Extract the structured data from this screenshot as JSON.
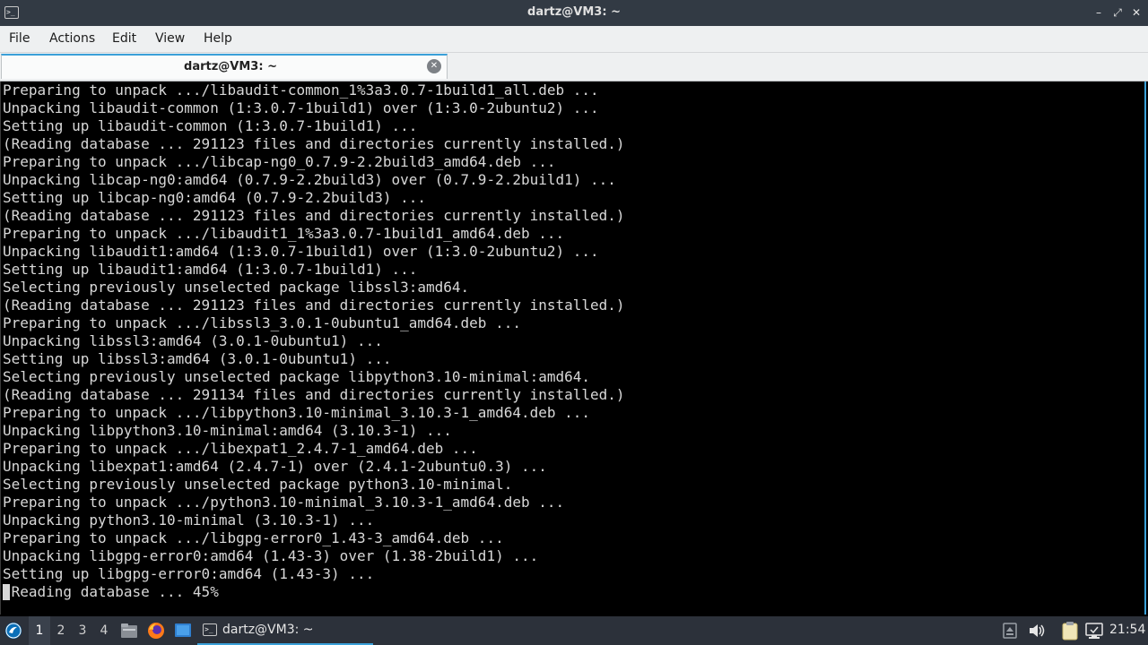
{
  "window": {
    "title": "dartz@VM3: ~",
    "icon": "terminal-icon",
    "controls": {
      "minimize": "–",
      "maximize": "⤢",
      "close": "✕"
    }
  },
  "menubar": {
    "file": "File",
    "actions": "Actions",
    "edit": "Edit",
    "view": "View",
    "help": "Help"
  },
  "tabs": [
    {
      "label": "dartz@VM3: ~",
      "close_icon": "close-circle-icon"
    }
  ],
  "terminal": {
    "lines": [
      "Preparing to unpack .../libaudit-common_1%3a3.0.7-1build1_all.deb ...",
      "Unpacking libaudit-common (1:3.0.7-1build1) over (1:3.0-2ubuntu2) ...",
      "Setting up libaudit-common (1:3.0.7-1build1) ...",
      "(Reading database ... 291123 files and directories currently installed.)",
      "Preparing to unpack .../libcap-ng0_0.7.9-2.2build3_amd64.deb ...",
      "Unpacking libcap-ng0:amd64 (0.7.9-2.2build3) over (0.7.9-2.2build1) ...",
      "Setting up libcap-ng0:amd64 (0.7.9-2.2build3) ...",
      "(Reading database ... 291123 files and directories currently installed.)",
      "Preparing to unpack .../libaudit1_1%3a3.0.7-1build1_amd64.deb ...",
      "Unpacking libaudit1:amd64 (1:3.0.7-1build1) over (1:3.0-2ubuntu2) ...",
      "Setting up libaudit1:amd64 (1:3.0.7-1build1) ...",
      "Selecting previously unselected package libssl3:amd64.",
      "(Reading database ... 291123 files and directories currently installed.)",
      "Preparing to unpack .../libssl3_3.0.1-0ubuntu1_amd64.deb ...",
      "Unpacking libssl3:amd64 (3.0.1-0ubuntu1) ...",
      "Setting up libssl3:amd64 (3.0.1-0ubuntu1) ...",
      "Selecting previously unselected package libpython3.10-minimal:amd64.",
      "(Reading database ... 291134 files and directories currently installed.)",
      "Preparing to unpack .../libpython3.10-minimal_3.10.3-1_amd64.deb ...",
      "Unpacking libpython3.10-minimal:amd64 (3.10.3-1) ...",
      "Preparing to unpack .../libexpat1_2.4.7-1_amd64.deb ...",
      "Unpacking libexpat1:amd64 (2.4.7-1) over (2.4.1-2ubuntu0.3) ...",
      "Selecting previously unselected package python3.10-minimal.",
      "Preparing to unpack .../python3.10-minimal_3.10.3-1_amd64.deb ...",
      "Unpacking python3.10-minimal (3.10.3-1) ...",
      "Preparing to unpack .../libgpg-error0_1.43-3_amd64.deb ...",
      "Unpacking libgpg-error0:amd64 (1.43-3) over (1.38-2build1) ...",
      "Setting up libgpg-error0:amd64 (1.43-3) ...",
      "(Reading database ... 45%"
    ]
  },
  "taskbar": {
    "start_icon": "lubuntu-logo-icon",
    "workspaces": [
      "1",
      "2",
      "3",
      "4"
    ],
    "active_workspace": "1",
    "launchers": [
      "file-manager-icon",
      "firefox-icon",
      "show-desktop-icon"
    ],
    "task": {
      "label": "dartz@VM3: ~",
      "icon": "terminal-icon"
    },
    "tray": [
      "keyboard-icon",
      "volume-icon",
      "clipboard-icon",
      "network-icon"
    ],
    "clock": "21:54"
  },
  "colors": {
    "accent": "#3aa0d8",
    "titlebar": "#323a44",
    "taskbar": "#2c313a",
    "terminal_bg": "#000000",
    "terminal_fg": "#d8d8d8"
  }
}
